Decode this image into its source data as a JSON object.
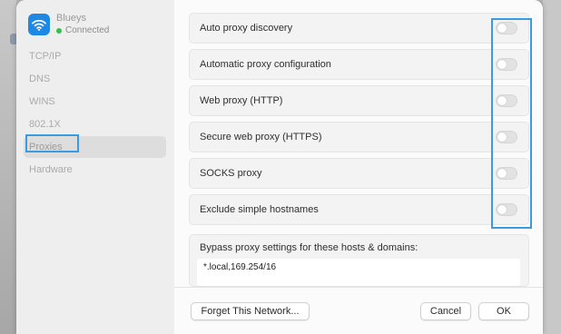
{
  "network": {
    "name": "Blueys",
    "status": "Connected",
    "icon": "wifi-icon",
    "accent": "#1e88e5",
    "status_color": "#31c04a"
  },
  "sidebar": {
    "items": [
      {
        "label": "TCP/IP"
      },
      {
        "label": "DNS"
      },
      {
        "label": "WINS"
      },
      {
        "label": "802.1X"
      },
      {
        "label": "Proxies"
      },
      {
        "label": "Hardware"
      }
    ],
    "selected": "Proxies"
  },
  "proxies": {
    "rows": [
      {
        "label": "Auto proxy discovery",
        "enabled": false
      },
      {
        "label": "Automatic proxy configuration",
        "enabled": false
      },
      {
        "label": "Web proxy (HTTP)",
        "enabled": false
      },
      {
        "label": "Secure web proxy (HTTPS)",
        "enabled": false
      },
      {
        "label": "SOCKS proxy",
        "enabled": false
      },
      {
        "label": "Exclude simple hostnames",
        "enabled": false
      }
    ],
    "bypass_label": "Bypass proxy settings for these hosts & domains:",
    "bypass_value": "*.local,169.254/16"
  },
  "footer": {
    "forget_label": "Forget This Network...",
    "cancel_label": "Cancel",
    "ok_label": "OK"
  },
  "annotation_color": "#3c9be0"
}
